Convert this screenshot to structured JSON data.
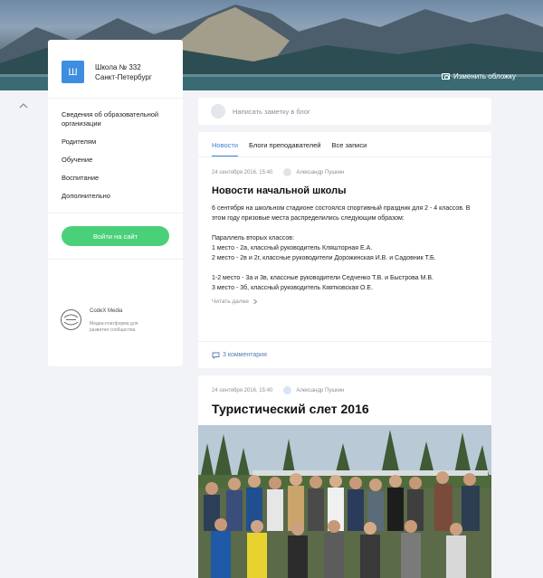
{
  "cover": {
    "change_label": "Изменить обложку"
  },
  "sidebar": {
    "logo_letter": "Ш",
    "school_name": "Школа № 332",
    "city": "Санкт-Петербург",
    "menu": [
      "Сведения об образовательной организации",
      "Родителям",
      "Обучение",
      "Воспитание",
      "Дополнительно"
    ],
    "login_button": "Войти на сайт",
    "codex": {
      "name": "CodeX Media",
      "desc": "Медиа-платформа для развития сообщества"
    }
  },
  "composer": {
    "placeholder": "Написать заметку в блог"
  },
  "tabs": [
    "Новости",
    "Блоги преподавателей",
    "Все записи"
  ],
  "post1": {
    "date": "24 сентября 2016, 15:40",
    "author": "Александр Пушкин",
    "title": "Новости начальной школы",
    "body": [
      "6 сентября на школьном стадионе состоялся спортивный праздник для 2 - 4 классов. В этом году призовые места распределились следующим образом:",
      "",
      "Параллель вторых классов:",
      "1 место - 2а, классный руководитель Кляшторная Е.А.",
      "2 место - 2в и 2г, классные руководители Дорожинская И.В. и Садовник Т.Б.",
      "",
      "1-2 место - 3а и 3в, классные руководители Седченко Т.В. и Быстрова М.В.",
      "3 место - 3б, классный руководитель Кяятковская О.Е."
    ],
    "read_more": "Читать далее",
    "comments": "3 комментария"
  },
  "post2": {
    "date": "24 сентября 2016, 15:40",
    "author": "Александр Пушкин",
    "title": "Туристический слет 2016"
  }
}
